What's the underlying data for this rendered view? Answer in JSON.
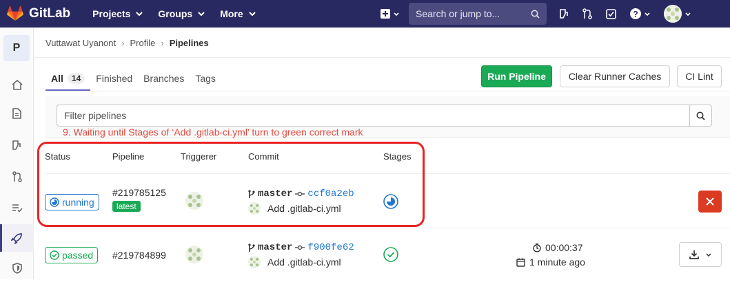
{
  "topbar": {
    "brand": "GitLab",
    "nav": [
      "Projects",
      "Groups",
      "More"
    ],
    "search_placeholder": "Search or jump to..."
  },
  "sidebar": {
    "project_letter": "P",
    "items": [
      "home-icon",
      "repository-icon",
      "issues-icon",
      "merge-requests-icon",
      "ci-cd-icon",
      "rocket-icon",
      "security-icon"
    ]
  },
  "breadcrumb": {
    "user": "Vuttawat Uyanont",
    "profile": "Profile",
    "current": "Pipelines"
  },
  "tabs": {
    "all": "All",
    "all_count": "14",
    "finished": "Finished",
    "branches": "Branches",
    "tags": "Tags"
  },
  "actions": {
    "run_pipeline": "Run Pipeline",
    "clear_caches": "Clear Runner Caches",
    "ci_lint": "CI Lint"
  },
  "filter": {
    "placeholder": "Filter pipelines"
  },
  "annotation": "9. Waiting until Stages of ‘Add .gitlab-ci.yml’ turn to green correct mark",
  "table": {
    "headers": {
      "status": "Status",
      "pipeline": "Pipeline",
      "triggerer": "Triggerer",
      "commit": "Commit",
      "stages": "Stages"
    },
    "rows": [
      {
        "status": "running",
        "pipeline_id": "#219785125",
        "badge": "latest",
        "branch": "master",
        "sha": "ccf0a2eb",
        "message": "Add .gitlab-ci.yml"
      },
      {
        "status": "passed",
        "pipeline_id": "#219784899",
        "branch": "master",
        "sha": "f900fe62",
        "message": "Add .gitlab-ci.yml",
        "duration": "00:00:37",
        "finished": "1 minute ago"
      }
    ]
  },
  "colors": {
    "topbar": "#292961",
    "running": "#1f78d1",
    "passed": "#1aaa55",
    "annotation": "#e8483c",
    "cancel": "#db3b21"
  }
}
